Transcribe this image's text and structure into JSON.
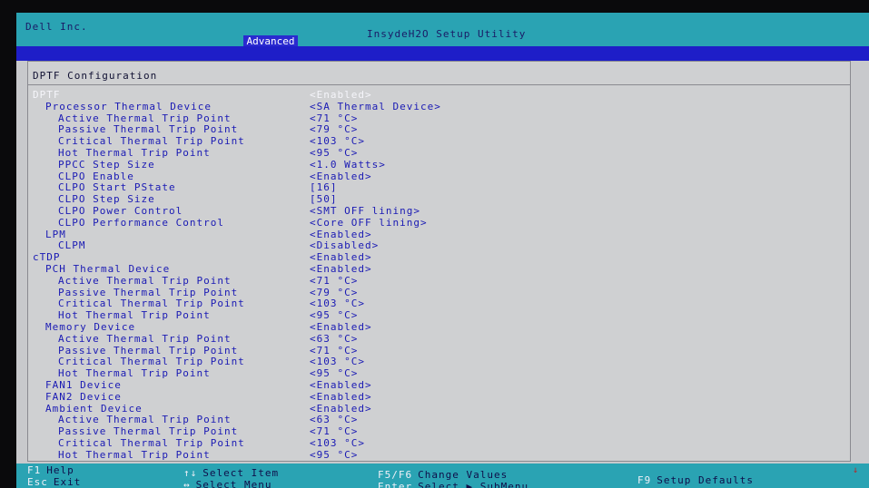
{
  "header": {
    "vendor": "Dell Inc.",
    "utility": "InsydeH2O Setup Utility",
    "active_tab": "Advanced"
  },
  "page": {
    "title": "DPTF Configuration"
  },
  "settings": [
    {
      "label": "DPTF",
      "value": "<Enabled>",
      "indent": 0,
      "highlighted": true
    },
    {
      "label": "Processor Thermal Device",
      "value": "<SA Thermal Device>",
      "indent": 1
    },
    {
      "label": "Active Thermal Trip Point",
      "value": "<71 °C>",
      "indent": 2
    },
    {
      "label": "Passive Thermal Trip Point",
      "value": "<79 °C>",
      "indent": 2
    },
    {
      "label": "Critical Thermal Trip Point",
      "value": "<103 °C>",
      "indent": 2
    },
    {
      "label": "Hot Thermal Trip Point",
      "value": "<95 °C>",
      "indent": 2
    },
    {
      "label": "PPCC Step Size",
      "value": "<1.0 Watts>",
      "indent": 2
    },
    {
      "label": "CLPO Enable",
      "value": "<Enabled>",
      "indent": 2
    },
    {
      "label": "CLPO Start PState",
      "value": "[16]",
      "indent": 2
    },
    {
      "label": "CLPO Step Size",
      "value": "[50]",
      "indent": 2
    },
    {
      "label": "CLPO Power Control",
      "value": "<SMT OFF lining>",
      "indent": 2
    },
    {
      "label": "CLPO Performance Control",
      "value": "<Core OFF lining>",
      "indent": 2
    },
    {
      "label": "LPM",
      "value": "<Enabled>",
      "indent": 1
    },
    {
      "label": "CLPM",
      "value": "<Disabled>",
      "indent": 2
    },
    {
      "label": "cTDP",
      "value": "<Enabled>",
      "indent": 0
    },
    {
      "label": "PCH Thermal Device",
      "value": "<Enabled>",
      "indent": 1
    },
    {
      "label": "Active Thermal Trip Point",
      "value": "<71 °C>",
      "indent": 2
    },
    {
      "label": "Passive Thermal Trip Point",
      "value": "<79 °C>",
      "indent": 2
    },
    {
      "label": "Critical Thermal Trip Point",
      "value": "<103 °C>",
      "indent": 2
    },
    {
      "label": "Hot Thermal Trip Point",
      "value": "<95 °C>",
      "indent": 2
    },
    {
      "label": "Memory Device",
      "value": "<Enabled>",
      "indent": 1
    },
    {
      "label": "Active Thermal Trip Point",
      "value": "<63 °C>",
      "indent": 2
    },
    {
      "label": "Passive Thermal Trip Point",
      "value": "<71 °C>",
      "indent": 2
    },
    {
      "label": "Critical Thermal Trip Point",
      "value": "<103 °C>",
      "indent": 2
    },
    {
      "label": "Hot Thermal Trip Point",
      "value": "<95 °C>",
      "indent": 2
    },
    {
      "label": "FAN1 Device",
      "value": "<Enabled>",
      "indent": 1
    },
    {
      "label": "FAN2 Device",
      "value": "<Enabled>",
      "indent": 1
    },
    {
      "label": "Ambient Device",
      "value": "<Enabled>",
      "indent": 1
    },
    {
      "label": "Active Thermal Trip Point",
      "value": "<63 °C>",
      "indent": 2
    },
    {
      "label": "Passive Thermal Trip Point",
      "value": "<71 °C>",
      "indent": 2
    },
    {
      "label": "Critical Thermal Trip Point",
      "value": "<103 °C>",
      "indent": 2
    },
    {
      "label": "Hot Thermal Trip Point",
      "value": "<95 °C>",
      "indent": 2
    }
  ],
  "footer": {
    "help_key": "F1",
    "help_label": "Help",
    "exit_key": "Esc",
    "exit_label": "Exit",
    "select_item_key": "↑↓",
    "select_item_label": "Select Item",
    "select_menu_key": "↔",
    "select_menu_label": "Select Menu",
    "change_key": "F5/F6",
    "change_label": "Change Values",
    "enter_key": "Enter",
    "enter_label": "Select ▶ SubMenu",
    "defaults_key": "F9",
    "defaults_label": "Setup Defaults"
  },
  "colors": {
    "title_bar": "#2aa3b3",
    "tab_bar": "#1e1ec8",
    "panel": "#cfd0d2",
    "item_text": "#1a1ab4"
  }
}
